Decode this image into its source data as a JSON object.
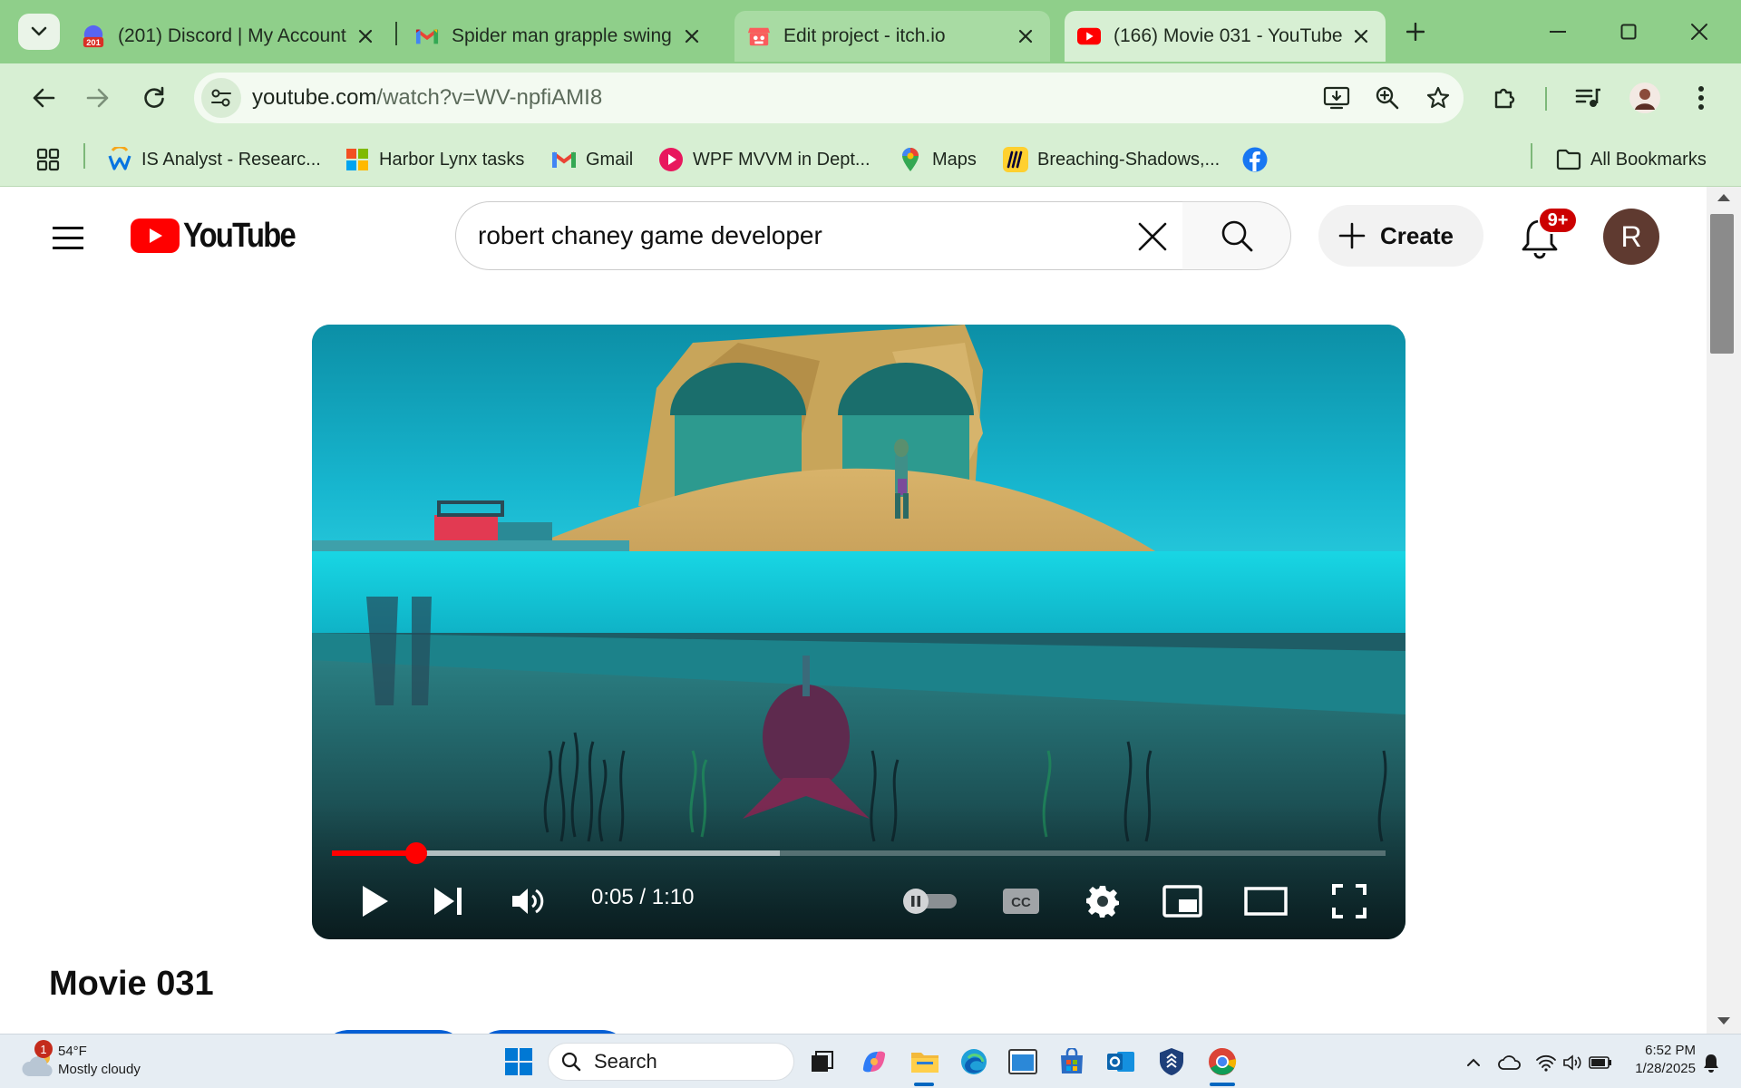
{
  "browser": {
    "tabs": [
      {
        "favicon": "discord-badge-icon",
        "badge": "201",
        "title": "(201) Discord | My Account",
        "state": "normal"
      },
      {
        "favicon": "gmail-icon",
        "title": "Spider man grapple swing",
        "state": "normal"
      },
      {
        "favicon": "itch-io-icon",
        "title": "Edit project - itch.io",
        "state": "hovered"
      },
      {
        "favicon": "youtube-icon",
        "title": "(166) Movie 031 - YouTube",
        "state": "active"
      }
    ],
    "url_host": "youtube.com",
    "url_path": "/watch?v=WV-npfiAMI8",
    "bookmarks": [
      {
        "icon": "workday-icon",
        "label": "IS Analyst - Researc..."
      },
      {
        "icon": "microsoft-icon",
        "label": "Harbor Lynx tasks"
      },
      {
        "icon": "gmail-icon",
        "label": "Gmail"
      },
      {
        "icon": "video-play-icon",
        "label": "WPF MVVM in Dept..."
      },
      {
        "icon": "maps-pin-icon",
        "label": "Maps"
      },
      {
        "icon": "miro-icon",
        "label": "Breaching-Shadows,..."
      },
      {
        "icon": "facebook-icon",
        "label": ""
      }
    ],
    "all_bookmarks_label": "All Bookmarks"
  },
  "youtube": {
    "logo_text": "YouTube",
    "search_query": "robert chaney game developer",
    "create_label": "Create",
    "notifications_badge": "9+",
    "avatar_letter": "R",
    "video": {
      "current_time": "0:05",
      "duration": "1:10",
      "time_display": "0:05 / 1:10",
      "played_fraction": 0.08,
      "buffered_fraction": 0.425,
      "autoplay": "off"
    },
    "title": "Movie 031"
  },
  "taskbar": {
    "weather_temp": "54°F",
    "weather_condition": "Mostly cloudy",
    "weather_badge": "1",
    "search_label": "Search",
    "time": "6:52 PM",
    "date": "1/28/2025"
  },
  "colors": {
    "chrome_frame": "#8fcf8a",
    "chrome_toolbar": "#d7efd3",
    "youtube_red": "#ff0000",
    "notification_red": "#cc0000"
  }
}
